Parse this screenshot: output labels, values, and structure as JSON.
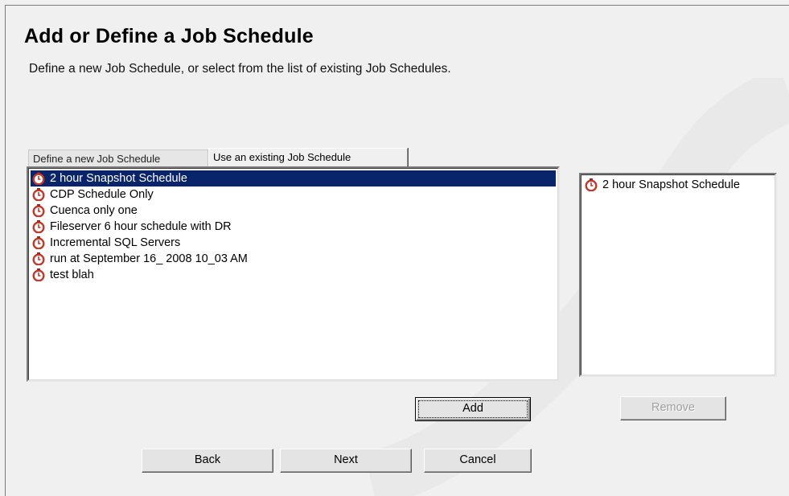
{
  "header": {
    "title": "Add or Define a Job Schedule",
    "subtitle": "Define a new Job Schedule, or select from the list of existing Job Schedules."
  },
  "tabs": [
    {
      "label": "Define a new Job Schedule",
      "active": false
    },
    {
      "label": "Use an existing Job Schedule",
      "active": true
    }
  ],
  "available_list": {
    "items": [
      {
        "label": "2 hour Snapshot Schedule",
        "selected": true
      },
      {
        "label": "CDP Schedule Only",
        "selected": false
      },
      {
        "label": "Cuenca only one",
        "selected": false
      },
      {
        "label": "Fileserver 6 hour schedule with DR",
        "selected": false
      },
      {
        "label": "Incremental SQL Servers",
        "selected": false
      },
      {
        "label": "run at September 16_ 2008 10_03 AM",
        "selected": false
      },
      {
        "label": "test blah",
        "selected": false
      }
    ]
  },
  "selected_list": {
    "items": [
      {
        "label": "2 hour Snapshot Schedule"
      }
    ]
  },
  "buttons": {
    "add": "Add",
    "remove": "Remove",
    "back": "Back",
    "next": "Next",
    "cancel": "Cancel"
  },
  "icons": {
    "schedule_item": "stopwatch-icon"
  },
  "colors": {
    "selection": "#0a246a",
    "icon": "#c0392b"
  }
}
